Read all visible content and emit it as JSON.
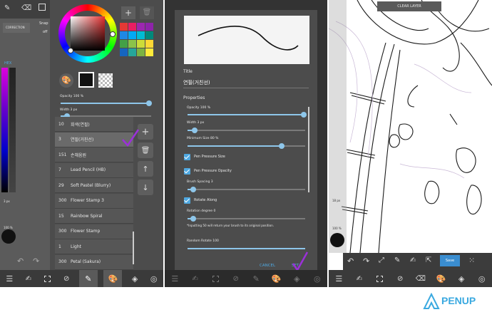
{
  "panel1": {
    "top_labels": {
      "brush_label": "CORRECTION",
      "snap_label": "Snap",
      "off_label": "off"
    },
    "hex_label": "HEX",
    "opacity_label": "Opacity 100 %",
    "width_label": "Width 3 px",
    "opacity_value": 100,
    "width_fraction": 0.07,
    "bottom_left_label": "3 px",
    "bottom_left_label2": "100 %",
    "swatch_colors": [
      "#e53935",
      "#e91e63",
      "#9c27b0",
      "#8e24aa",
      "#1e88e5",
      "#03a9f4",
      "#00bcd4",
      "#00897b",
      "#43a047",
      "#8bc34a",
      "#cddc39",
      "#fdd835",
      "#1565c0",
      "#26a69a",
      "#7cb342",
      "#ffeb3b"
    ],
    "brushes": [
      {
        "size": "10",
        "name": "회색(연필)"
      },
      {
        "size": "3",
        "name": "연필(거친선)"
      },
      {
        "size": "151",
        "name": "손채움원"
      },
      {
        "size": "7",
        "name": "Lead Pencil (HB)"
      },
      {
        "size": "29",
        "name": "Soft Pastel (Blurry)"
      },
      {
        "size": "300",
        "name": "Flower Stamp 3"
      },
      {
        "size": "15",
        "name": "Rainbow Spiral"
      },
      {
        "size": "300",
        "name": "Flower Stamp"
      },
      {
        "size": "1",
        "name": "Light"
      },
      {
        "size": "300",
        "name": "Petal (Sakura)"
      }
    ],
    "accent_color": "#9b30d9"
  },
  "panel2": {
    "title_label": "Title",
    "title_value": "연필(거친선)",
    "properties_label": "Properties",
    "opacity_label": "Opacity 100 %",
    "width_label": "Width 3 px",
    "min_size_label": "Minimum Size 80 %",
    "pen_pressure_size": "Pen Pressure Size",
    "pen_pressure_opacity": "Pen Pressure Opacity",
    "brush_spacing": "Brush Spacing 3",
    "rotate_along": "Rotate Along",
    "rotation_degree": "Rotation degree 0",
    "note": "*Inputting 50 will return your brush to its original position.",
    "random_rotate": "Random Rotate 100",
    "cancel": "CANCEL",
    "set": "SET",
    "opacity_value": 100,
    "width_fraction": 0.06,
    "min_size_value": 80,
    "brush_spacing_fraction": 0.05,
    "rotation_fraction": 0.05,
    "random_rotate_value": 100
  },
  "panel3": {
    "clear_layer": "CLEAR LAYER",
    "save": "Save",
    "left_label1": "18 px",
    "left_label2": "100 %"
  },
  "brand": {
    "name": "PENUP",
    "color": "#3aa9e0"
  }
}
